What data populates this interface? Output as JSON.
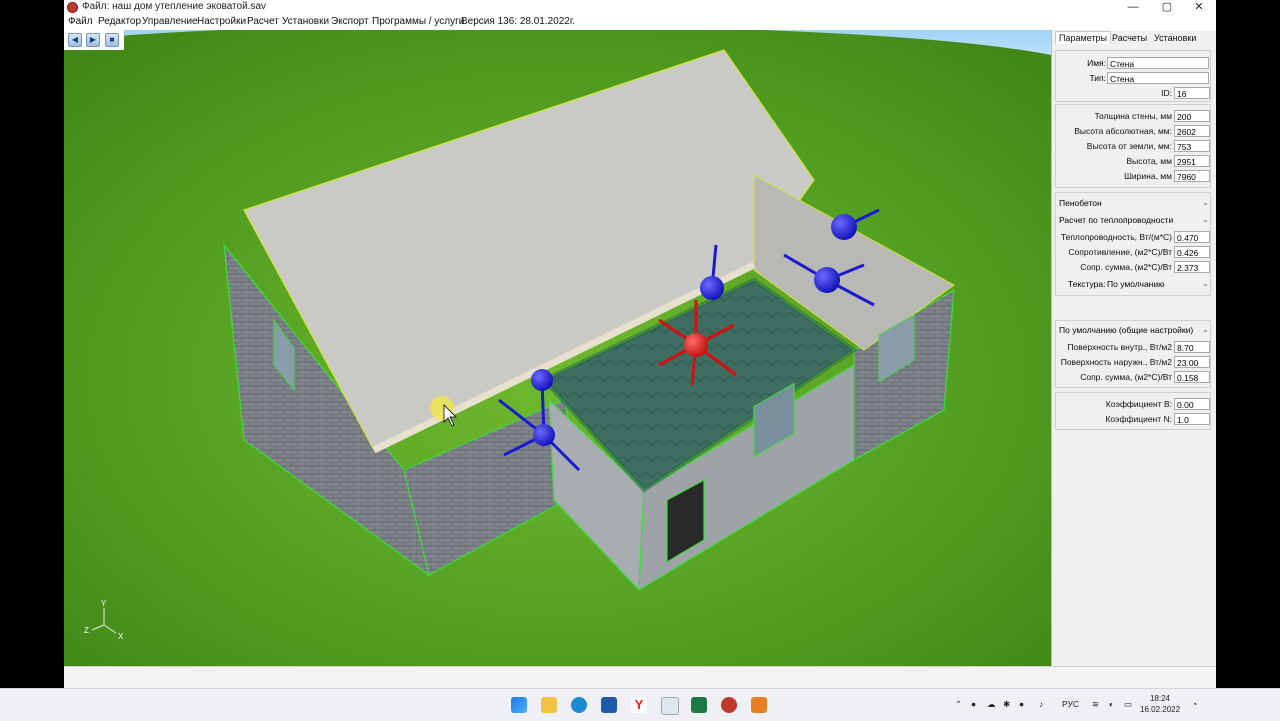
{
  "window": {
    "title": "Файл: наш дом утепление эковатой.sav",
    "controls": {
      "minimize": "—",
      "maximize": "▢",
      "close": "✕"
    }
  },
  "menu": [
    "Файл",
    "Редактор",
    "Управление",
    "Настройки",
    "Расчет",
    "Установки",
    "Экспорт",
    "Программы / услуги",
    "Версия 136: 28.01.2022г."
  ],
  "toolbar": {
    "icons": [
      "back-arrow-icon",
      "forward-arrow-icon",
      "save-icon"
    ]
  },
  "viewport": {
    "axes": {
      "y": "Y",
      "z": "Z",
      "x": "X"
    }
  },
  "panel": {
    "tabs": [
      "Параметры",
      "Расчеты",
      "Установки"
    ],
    "identity": [
      {
        "label": "Имя:",
        "value": "Стена"
      },
      {
        "label": "Тип:",
        "value": "Стена"
      },
      {
        "label": "ID:",
        "value": "16"
      }
    ],
    "geometry": [
      {
        "label": "Толщина стены, мм",
        "value": "200"
      },
      {
        "label": "Высота абсолютная, мм:",
        "value": "2602"
      },
      {
        "label": "Высота от земли, мм:",
        "value": "753"
      },
      {
        "label": "Высота, мм",
        "value": "2951"
      },
      {
        "label": "Ширина, мм",
        "value": "7960"
      }
    ],
    "material": {
      "name": "Пенобетон",
      "calc_mode": "Расчет по теплопроводности",
      "rows": [
        {
          "label": "Теплопроводность, Вт/(м*С)",
          "value": "0.470"
        },
        {
          "label": "Сопротивление, (м2*С)/Вт",
          "value": "0.426"
        },
        {
          "label": "Сопр. сумма, (м2*С)/Вт",
          "value": "2.373"
        }
      ],
      "texture_label": "Текстура:",
      "texture_value": "По умолчанию"
    },
    "surface": {
      "preset": "По умолчанию (общие настройки)",
      "rows": [
        {
          "label": "Поверхность внутр., Вт/м2",
          "value": "8.70"
        },
        {
          "label": "Поверхность наружн., Вт/м2",
          "value": "23.00"
        },
        {
          "label": "Сопр. сумма, (м2*С)/Вт",
          "value": "0.158"
        }
      ]
    },
    "coeffs": [
      {
        "label": "Коэффициент В:",
        "value": "0.00"
      },
      {
        "label": "Коэффициент N:",
        "value": "1.0"
      }
    ]
  },
  "taskbar": {
    "lang": "РУС",
    "time": "18:24",
    "date": "16.02.2022"
  }
}
